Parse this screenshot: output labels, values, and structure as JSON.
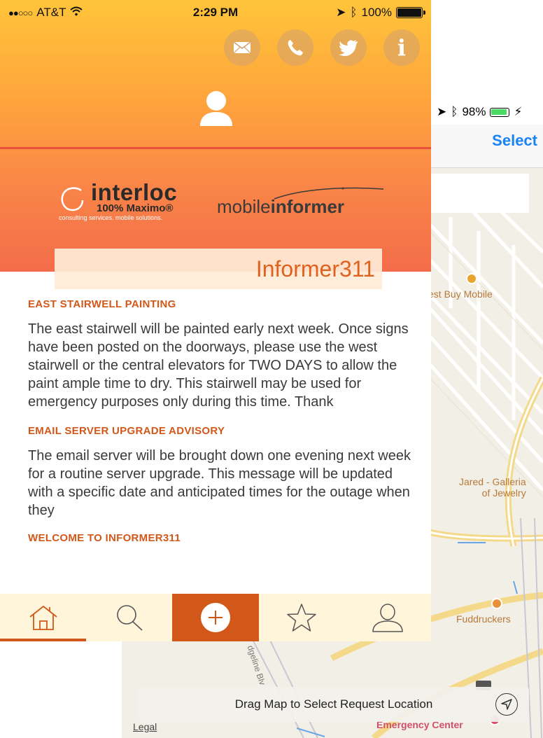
{
  "background_screen": {
    "status": {
      "battery_percent": "98%"
    },
    "nav": {
      "select_label": "Select"
    },
    "map": {
      "poi": {
        "best_buy": "est Buy Mobile",
        "jared_line1": "Jared - Galleria",
        "jared_line2": "of Jewelry",
        "fuddruckers": "Fuddruckers",
        "emergency": "Emergency Center"
      },
      "street": "dgeline Blv",
      "drag_hint": "Drag Map to Select Request Location",
      "legal": "Legal"
    }
  },
  "status_bar": {
    "carrier": "AT&T",
    "signal": "●●○○○",
    "time": "2:29 PM",
    "battery_percent": "100%"
  },
  "hero": {
    "contact_icons": [
      "mail-icon",
      "phone-icon",
      "twitter-icon",
      "info-icon"
    ],
    "info_glyph": "i",
    "logo_interloc": {
      "name": "interloc",
      "tagline": "100% Maximo®",
      "subtag": "consulting services. mobile solutions."
    },
    "logo_mobile": {
      "prefix": "mobile",
      "suffix": "informer"
    },
    "app_title": "Informer311"
  },
  "news": [
    {
      "title": "EAST STAIRWELL PAINTING",
      "body": "The east stairwell will be painted early next week. Once signs have been posted on the doorways, please use the west stairwell or the central elevators for TWO DAYS to allow the paint ample time to dry. This stairwell may be used for emergency purposes only during this time. Thank"
    },
    {
      "title": "EMAIL SERVER UPGRADE ADVISORY",
      "body": "The email server will be brought down one evening next week for a routine server upgrade. This message will be updated with a specific date and anticipated times for the outage when they"
    },
    {
      "title": "WELCOME TO INFORMER311",
      "body": ""
    }
  ],
  "tabbar": {
    "tabs": [
      "home-icon",
      "search-icon",
      "add-icon",
      "star-icon",
      "profile-icon"
    ],
    "active": "home-icon",
    "accent": "#d2581a",
    "background": "#fff5da"
  }
}
